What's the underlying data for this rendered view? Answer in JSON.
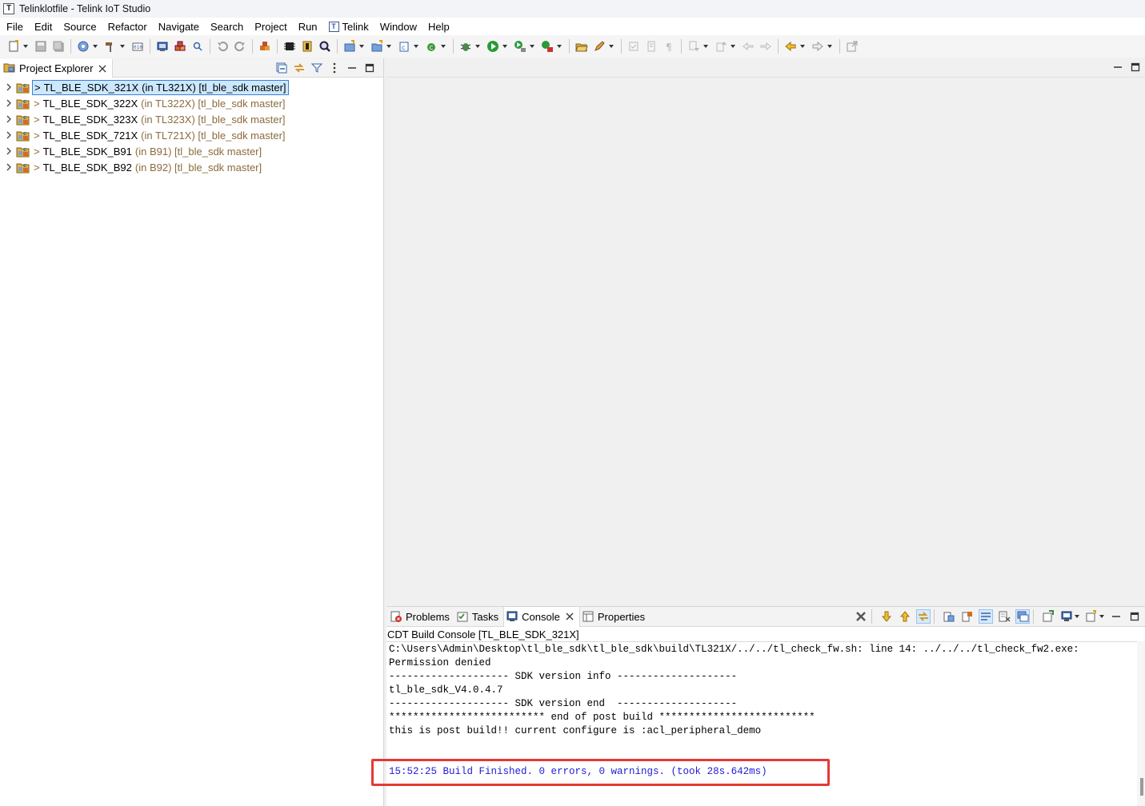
{
  "window": {
    "title": "Telinklotfile - Telink IoT Studio"
  },
  "menu": {
    "items": [
      "File",
      "Edit",
      "Source",
      "Refactor",
      "Navigate",
      "Search",
      "Project",
      "Run",
      "Telink",
      "Window",
      "Help"
    ]
  },
  "project_explorer": {
    "tab_label": "Project Explorer",
    "projects": [
      {
        "prefix": ">",
        "name": "TL_BLE_SDK_321X",
        "decoration": "(in TL321X) [tl_ble_sdk master]",
        "selected": true
      },
      {
        "prefix": ">",
        "name": "TL_BLE_SDK_322X",
        "decoration": "(in TL322X) [tl_ble_sdk master]",
        "selected": false
      },
      {
        "prefix": ">",
        "name": "TL_BLE_SDK_323X",
        "decoration": "(in TL323X) [tl_ble_sdk master]",
        "selected": false
      },
      {
        "prefix": ">",
        "name": "TL_BLE_SDK_721X",
        "decoration": "(in TL721X) [tl_ble_sdk master]",
        "selected": false
      },
      {
        "prefix": ">",
        "name": "TL_BLE_SDK_B91",
        "decoration": "(in B91) [tl_ble_sdk master]",
        "selected": false
      },
      {
        "prefix": ">",
        "name": "TL_BLE_SDK_B92",
        "decoration": "(in B92) [tl_ble_sdk master]",
        "selected": false
      }
    ]
  },
  "bottom_panel": {
    "tabs": {
      "problems": "Problems",
      "tasks": "Tasks",
      "console": "Console",
      "properties": "Properties"
    },
    "console_title": "CDT Build Console [TL_BLE_SDK_321X]",
    "lines": [
      "C:\\Users\\Admin\\Desktop\\tl_ble_sdk\\tl_ble_sdk\\build\\TL321X/../../tl_check_fw.sh: line 14: ../../../tl_check_fw2.exe:",
      "Permission denied",
      "-------------------- SDK version info --------------------",
      "tl_ble_sdk_V4.0.4.7",
      "-------------------- SDK version end  --------------------",
      "************************** end of post build **************************",
      "this is post build!! current configure is :acl_peripheral_demo",
      "",
      ""
    ],
    "build_result": "15:52:25 Build Finished. 0 errors, 0 warnings. (took 28s.642ms)"
  },
  "colors": {
    "selection_bg": "#cce8ff",
    "selection_border": "#3d7ed8",
    "decoration": "#8a6d3b",
    "build_finished": "#2020d8",
    "highlight_box": "#e53935"
  }
}
